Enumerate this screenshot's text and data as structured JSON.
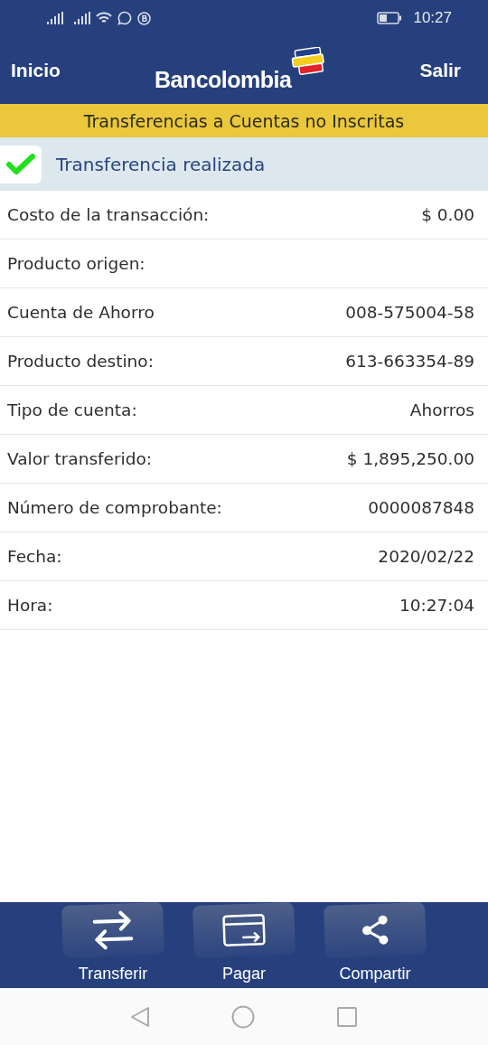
{
  "status_bar": {
    "time": "10:27"
  },
  "header": {
    "left": "Inicio",
    "logo": "Bancolombia",
    "right": "Salir"
  },
  "section_title": "Transferencias a Cuentas no Inscritas",
  "result": {
    "message": "Transferencia realizada",
    "success": true
  },
  "details": [
    {
      "label": "Costo de la transacción:",
      "value": "$ 0.00"
    },
    {
      "label": "Producto origen:"
    },
    {
      "label": "Cuenta de Ahorro",
      "value": "008-575004-58"
    },
    {
      "label": "Producto destino:",
      "value": "613-663354-89"
    },
    {
      "label": "Tipo de cuenta:",
      "value": "Ahorros"
    },
    {
      "label": "Valor transferido:",
      "value": "$ 1,895,250.00"
    },
    {
      "label": "Número de comprobante:",
      "value": "0000087848"
    },
    {
      "label": "Fecha:",
      "value": "2020/02/22"
    },
    {
      "label": "Hora:",
      "value": "10:27:04"
    }
  ],
  "actions": [
    {
      "kind": "transfer",
      "label": "Transferir"
    },
    {
      "kind": "pay",
      "label": "Pagar"
    },
    {
      "kind": "share",
      "label": "Compartir"
    }
  ]
}
